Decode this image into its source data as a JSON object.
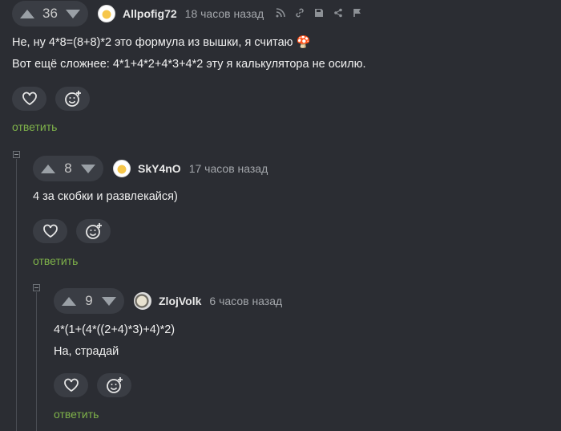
{
  "comments": [
    {
      "votes": "36",
      "author": "Allpofig72",
      "time": "18 часов назад",
      "lines": [
        "Не, ну 4*8=(8+8)*2 это формула из вышки, я считаю 🍄",
        "Вот ещё сложнее: 4*1+4*2+4*3+4*2 эту я калькулятора не осилю."
      ],
      "reply_label": "ответить"
    },
    {
      "votes": "8",
      "author": "SkY4nO",
      "time": "17 часов назад",
      "lines": [
        "4 за скобки и развлекайся)"
      ],
      "reply_label": "ответить"
    },
    {
      "votes": "9",
      "author": "ZlojVolk",
      "time": "6 часов назад",
      "lines": [
        "4*(1+(4*((2+4)*3)+4)*2)",
        "На, страдай"
      ],
      "reply_label": "ответить"
    }
  ],
  "icons": {
    "upvote": "triangle-up",
    "downvote": "triangle-down",
    "like": "heart",
    "react": "smile-plus",
    "tools": [
      "rss",
      "link",
      "save",
      "share",
      "flag"
    ]
  },
  "colors": {
    "background": "#2b2d33",
    "reply": "#7fb34a",
    "pill": "#3a3d44"
  }
}
